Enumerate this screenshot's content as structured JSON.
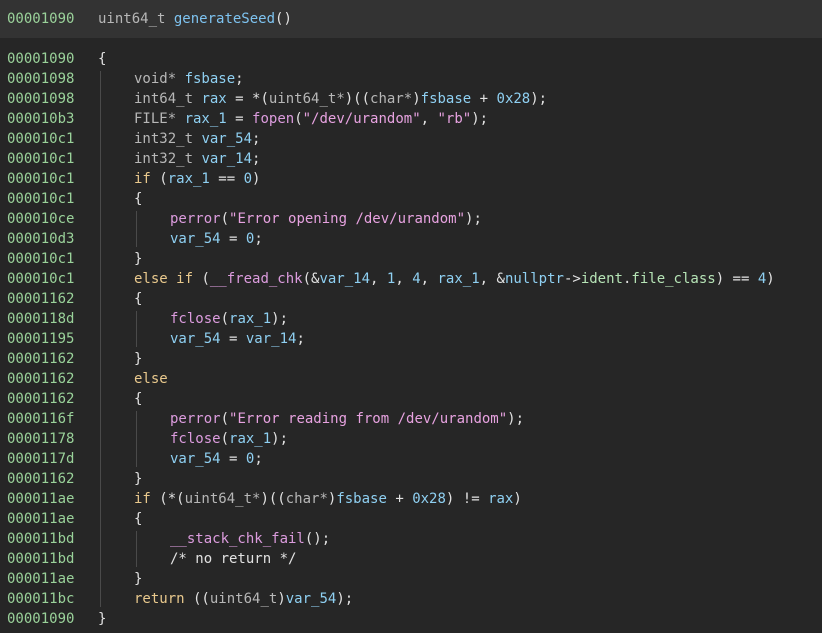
{
  "header": {
    "address": "00001090",
    "return_type": "uint64_t",
    "function_name": "generateSeed",
    "params": "()"
  },
  "lines": [
    {
      "addr": "00001090",
      "indent": 0,
      "tokens": [
        [
          "plain",
          "{"
        ]
      ]
    },
    {
      "addr": "00001098",
      "indent": 1,
      "tokens": [
        [
          "ty",
          "void* "
        ],
        [
          "var",
          "fsbase"
        ],
        [
          "plain",
          ";"
        ]
      ]
    },
    {
      "addr": "00001098",
      "indent": 1,
      "tokens": [
        [
          "ty",
          "int64_t "
        ],
        [
          "var",
          "rax"
        ],
        [
          "plain",
          " = *("
        ],
        [
          "ty",
          "uint64_t*"
        ],
        [
          "plain",
          ")(("
        ],
        [
          "ty",
          "char*"
        ],
        [
          "plain",
          ")"
        ],
        [
          "var",
          "fsbase"
        ],
        [
          "plain",
          " + "
        ],
        [
          "num",
          "0x28"
        ],
        [
          "plain",
          ");"
        ]
      ]
    },
    {
      "addr": "000010b3",
      "indent": 1,
      "tokens": [
        [
          "ty",
          "FILE* "
        ],
        [
          "var",
          "rax_1"
        ],
        [
          "plain",
          " = "
        ],
        [
          "fn",
          "fopen"
        ],
        [
          "plain",
          "("
        ],
        [
          "str",
          "\"/dev/urandom\""
        ],
        [
          "plain",
          ", "
        ],
        [
          "str",
          "\"rb\""
        ],
        [
          "plain",
          ");"
        ]
      ]
    },
    {
      "addr": "000010c1",
      "indent": 1,
      "tokens": [
        [
          "ty",
          "int32_t "
        ],
        [
          "var",
          "var_54"
        ],
        [
          "plain",
          ";"
        ]
      ]
    },
    {
      "addr": "000010c1",
      "indent": 1,
      "tokens": [
        [
          "ty",
          "int32_t "
        ],
        [
          "var",
          "var_14"
        ],
        [
          "plain",
          ";"
        ]
      ]
    },
    {
      "addr": "000010c1",
      "indent": 1,
      "tokens": [
        [
          "kw",
          "if"
        ],
        [
          "plain",
          " ("
        ],
        [
          "var",
          "rax_1"
        ],
        [
          "plain",
          " == "
        ],
        [
          "num",
          "0"
        ],
        [
          "plain",
          ")"
        ]
      ]
    },
    {
      "addr": "000010c1",
      "indent": 1,
      "tokens": [
        [
          "plain",
          "{"
        ]
      ]
    },
    {
      "addr": "000010ce",
      "indent": 2,
      "tokens": [
        [
          "fn",
          "perror"
        ],
        [
          "plain",
          "("
        ],
        [
          "str",
          "\"Error opening /dev/urandom\""
        ],
        [
          "plain",
          ");"
        ]
      ]
    },
    {
      "addr": "000010d3",
      "indent": 2,
      "tokens": [
        [
          "var",
          "var_54"
        ],
        [
          "plain",
          " = "
        ],
        [
          "num",
          "0"
        ],
        [
          "plain",
          ";"
        ]
      ]
    },
    {
      "addr": "000010c1",
      "indent": 1,
      "tokens": [
        [
          "plain",
          "}"
        ]
      ]
    },
    {
      "addr": "000010c1",
      "indent": 1,
      "tokens": [
        [
          "kw",
          "else if"
        ],
        [
          "plain",
          " ("
        ],
        [
          "fn",
          "__fread_chk"
        ],
        [
          "plain",
          "(&"
        ],
        [
          "var",
          "var_14"
        ],
        [
          "plain",
          ", "
        ],
        [
          "num",
          "1"
        ],
        [
          "plain",
          ", "
        ],
        [
          "num",
          "4"
        ],
        [
          "plain",
          ", "
        ],
        [
          "var",
          "rax_1"
        ],
        [
          "plain",
          ", &"
        ],
        [
          "var",
          "nullptr"
        ],
        [
          "plain",
          "->"
        ],
        [
          "fld",
          "ident"
        ],
        [
          "plain",
          "."
        ],
        [
          "fld",
          "file_class"
        ],
        [
          "plain",
          ") == "
        ],
        [
          "num",
          "4"
        ],
        [
          "plain",
          ")"
        ]
      ]
    },
    {
      "addr": "00001162",
      "indent": 1,
      "tokens": [
        [
          "plain",
          "{"
        ]
      ]
    },
    {
      "addr": "0000118d",
      "indent": 2,
      "tokens": [
        [
          "fn",
          "fclose"
        ],
        [
          "plain",
          "("
        ],
        [
          "var",
          "rax_1"
        ],
        [
          "plain",
          ");"
        ]
      ]
    },
    {
      "addr": "00001195",
      "indent": 2,
      "tokens": [
        [
          "var",
          "var_54"
        ],
        [
          "plain",
          " = "
        ],
        [
          "var",
          "var_14"
        ],
        [
          "plain",
          ";"
        ]
      ]
    },
    {
      "addr": "00001162",
      "indent": 1,
      "tokens": [
        [
          "plain",
          "}"
        ]
      ]
    },
    {
      "addr": "00001162",
      "indent": 1,
      "tokens": [
        [
          "kw",
          "else"
        ]
      ]
    },
    {
      "addr": "00001162",
      "indent": 1,
      "tokens": [
        [
          "plain",
          "{"
        ]
      ]
    },
    {
      "addr": "0000116f",
      "indent": 2,
      "tokens": [
        [
          "fn",
          "perror"
        ],
        [
          "plain",
          "("
        ],
        [
          "str",
          "\"Error reading from /dev/urandom\""
        ],
        [
          "plain",
          ");"
        ]
      ]
    },
    {
      "addr": "00001178",
      "indent": 2,
      "tokens": [
        [
          "fn",
          "fclose"
        ],
        [
          "plain",
          "("
        ],
        [
          "var",
          "rax_1"
        ],
        [
          "plain",
          ");"
        ]
      ]
    },
    {
      "addr": "0000117d",
      "indent": 2,
      "tokens": [
        [
          "var",
          "var_54"
        ],
        [
          "plain",
          " = "
        ],
        [
          "num",
          "0"
        ],
        [
          "plain",
          ";"
        ]
      ]
    },
    {
      "addr": "00001162",
      "indent": 1,
      "tokens": [
        [
          "plain",
          "}"
        ]
      ]
    },
    {
      "addr": "000011ae",
      "indent": 1,
      "tokens": [
        [
          "kw",
          "if"
        ],
        [
          "plain",
          " (*("
        ],
        [
          "ty",
          "uint64_t*"
        ],
        [
          "plain",
          ")(("
        ],
        [
          "ty",
          "char*"
        ],
        [
          "plain",
          ")"
        ],
        [
          "var",
          "fsbase"
        ],
        [
          "plain",
          " + "
        ],
        [
          "num",
          "0x28"
        ],
        [
          "plain",
          ") != "
        ],
        [
          "var",
          "rax"
        ],
        [
          "plain",
          ")"
        ]
      ]
    },
    {
      "addr": "000011ae",
      "indent": 1,
      "tokens": [
        [
          "plain",
          "{"
        ]
      ]
    },
    {
      "addr": "000011bd",
      "indent": 2,
      "tokens": [
        [
          "fn",
          "__stack_chk_fail"
        ],
        [
          "plain",
          "();"
        ]
      ]
    },
    {
      "addr": "000011bd",
      "indent": 2,
      "tokens": [
        [
          "plain",
          "/* no return */"
        ]
      ]
    },
    {
      "addr": "000011ae",
      "indent": 1,
      "tokens": [
        [
          "plain",
          "}"
        ]
      ]
    },
    {
      "addr": "000011bc",
      "indent": 1,
      "tokens": [
        [
          "kw",
          "return"
        ],
        [
          "plain",
          " (("
        ],
        [
          "ty",
          "uint64_t"
        ],
        [
          "plain",
          ")"
        ],
        [
          "var",
          "var_54"
        ],
        [
          "plain",
          ");"
        ]
      ]
    },
    {
      "addr": "00001090",
      "indent": 0,
      "tokens": [
        [
          "plain",
          "}"
        ]
      ]
    }
  ]
}
